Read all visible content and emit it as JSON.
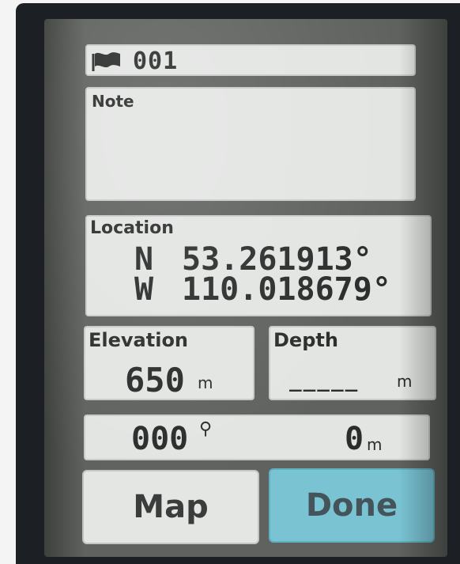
{
  "waypoint": {
    "name": "001",
    "icon": "flag-icon"
  },
  "note": {
    "label": "Note",
    "value": ""
  },
  "location": {
    "label": "Location",
    "lat_hemisphere": "N",
    "lat_value": "53.261913°",
    "lon_hemisphere": "W",
    "lon_value": "110.018679°"
  },
  "elevation": {
    "label": "Elevation",
    "value": "650",
    "unit": "m"
  },
  "depth": {
    "label": "Depth",
    "value": "_____",
    "unit": "m"
  },
  "status": {
    "heading": "000",
    "heading_icon": "pin-icon",
    "distance": "0",
    "distance_unit": "m"
  },
  "buttons": {
    "map_label": "Map",
    "done_label": "Done"
  },
  "colors": {
    "panel": "#e3e5e3",
    "done_accent": "#79c3d3",
    "screen_bezel": "#1c1f24"
  }
}
